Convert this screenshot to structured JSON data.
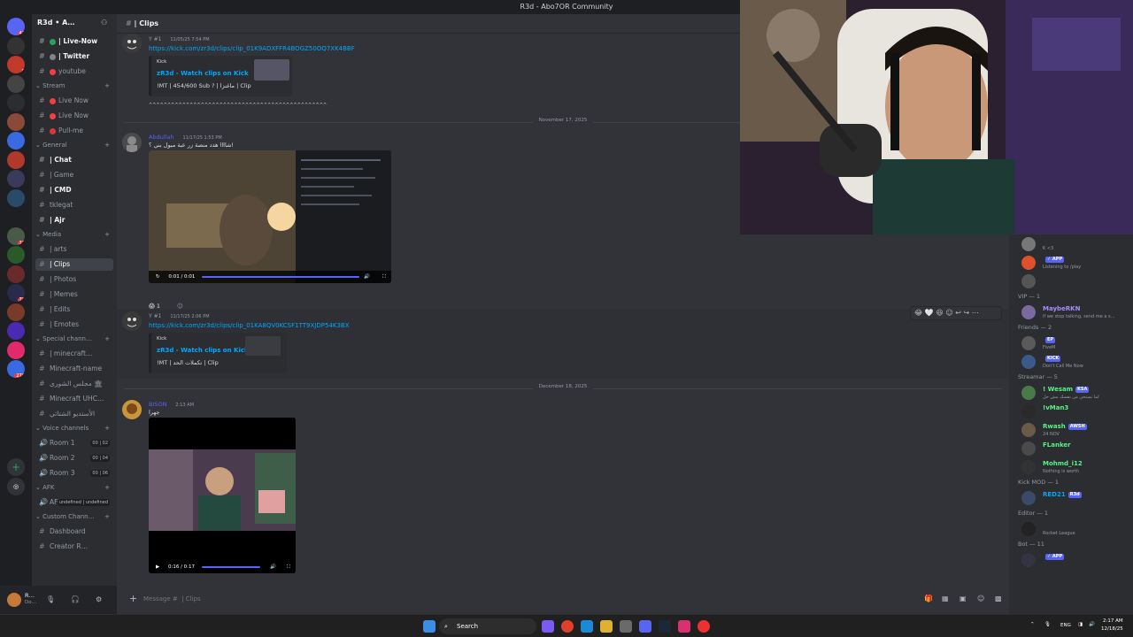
{
  "window": {
    "title": "R3d - Abo7OR Community"
  },
  "servers": [
    {
      "badge": "41"
    },
    {
      "badge": ""
    },
    {
      "badge": "5"
    },
    {
      "badge": ""
    },
    {
      "badge": ""
    },
    {
      "badge": ""
    },
    {
      "badge": ""
    },
    {
      "badge": ""
    },
    {
      "badge": ""
    },
    {
      "badge": ""
    },
    {
      "badge": ""
    },
    {
      "badge": "17"
    },
    {
      "badge": ""
    },
    {
      "badge": ""
    },
    {
      "badge": "76"
    },
    {
      "badge": ""
    },
    {
      "badge": ""
    },
    {
      "badge": "4"
    },
    {
      "badge": "276"
    }
  ],
  "guild": {
    "name": "R3d • A…"
  },
  "channels": {
    "top": [
      {
        "label": "| Live-Now",
        "dot": "#23a55a"
      },
      {
        "label": "| Twitter",
        "dot": "#80848e"
      },
      {
        "label": "youtube",
        "dot": "#f23f43"
      }
    ],
    "stream_label": "Stream",
    "stream": [
      {
        "label": "Live Now",
        "dot": "#f23f43"
      },
      {
        "label": "Live Now",
        "dot": "#f23f43"
      },
      {
        "label": "Pull-me",
        "dot": "#da373c"
      }
    ],
    "general_label": "General",
    "general": [
      {
        "label": "| Chat"
      },
      {
        "label": "| Game"
      },
      {
        "label": "| CMD"
      },
      {
        "label": "tklegat"
      },
      {
        "label": "| Ajr"
      }
    ],
    "media_label": "Media",
    "media": [
      {
        "label": "| arts"
      },
      {
        "label": "| Clips"
      },
      {
        "label": "| Photos"
      },
      {
        "label": "| Memes"
      },
      {
        "label": "| Edits"
      },
      {
        "label": "| Emotes"
      }
    ],
    "special_label": "Special chann…",
    "special": [
      {
        "label": "| minecraft…"
      },
      {
        "label": "Minecraft-name"
      },
      {
        "label": "مجلس الشورى 🏛"
      },
      {
        "label": "Minecraft UHC…"
      },
      {
        "label": "الأستديو الشتائي"
      }
    ],
    "voice_label": "Voice channels",
    "voice": [
      {
        "label": "Room 1",
        "c1": "00",
        "c2": "02"
      },
      {
        "label": "Room 2",
        "c1": "00",
        "c2": "04"
      },
      {
        "label": "Room 3",
        "c1": "00",
        "c2": "06"
      }
    ],
    "afk_label": "AFK",
    "afk": [
      {
        "label": "AFK"
      }
    ],
    "custom_label": "Custom Chann…",
    "custom": [
      {
        "label": "Dashboard"
      },
      {
        "label": "Creator R…"
      }
    ]
  },
  "user_panel": {
    "name": "R…",
    "status": "Do…"
  },
  "header": {
    "channel": "| Clips"
  },
  "messages": [
    {
      "tag": "Y #1",
      "time": "11/05/25 7:54 PM",
      "link": "https://kick.com/zr3d/clips/clip_01K9ADXFFR4BOGZ50OQ7XK4BBF",
      "embed_provider": "Kick",
      "embed_title": "zR3d - Watch clips on Kick",
      "embed_desc": "!MT | 454/600 Sub ? | ماغنزا | Clip",
      "extra": "^^^^^^^^^^^^^^^^^^^^^^^^^^^^^^^^^^^^^^^^^^^^^^^^"
    },
    {
      "date": "November 17, 2025",
      "author": "Abdullah",
      "time": "11/17/25 1:53 PM",
      "text": "شاااا هدد منصة زر عبة مبول بني ؟!",
      "video_time": "0:01 / 0:01",
      "reaction_count": "1"
    },
    {
      "tag": "Y #1",
      "time": "11/17/25 2:06 PM",
      "link": "https://kick.com/zr3d/clips/clip_01KA8QV0KCSF1TT9XJDP54K3BX",
      "embed_provider": "Kick",
      "embed_title": "zR3d - Watch clips on Kick",
      "embed_desc": "!MT | تكملات الحد | Clip"
    },
    {
      "date": "December 18, 2025",
      "author": "BISON",
      "time": "2:13 AM",
      "text": "جهرا",
      "video_time": "0:16 / 0:17"
    }
  ],
  "composer": {
    "placeholder": "Message #  | Clips"
  },
  "members": {
    "top": [
      {
        "name": "",
        "sub": "K <3",
        "color": "#f2f3f5"
      },
      {
        "name": "",
        "sub": "Listening to /play",
        "color": "#f2f3f5",
        "tag": "✓ APP"
      },
      {
        "name": "",
        "sub": "",
        "color": "#f2f3f5"
      }
    ],
    "vip_label": "VIP — 1",
    "vip": [
      {
        "name": "MaybeRKN",
        "sub": "If we stop talking, send me a s…",
        "color": "#a78bfa"
      }
    ],
    "friends_label": "Friends — 2",
    "friends": [
      {
        "name": "",
        "sub": "FiveM",
        "color": "#5865f2",
        "tag": "EP"
      },
      {
        "name": "",
        "sub": "Don't Call Me Now",
        "color": "#23a55a",
        "tag": "KICK"
      }
    ],
    "streamer_label": "Streamar — 5",
    "streamer": [
      {
        "name": "! Wesam",
        "sub": "لما تستحي من نفسك مش حل",
        "color": "#57f287",
        "tag": "KSA"
      },
      {
        "name": "!vMan3",
        "sub": "",
        "color": "#57f287"
      },
      {
        "name": "Rwash",
        "sub": "24 NOV",
        "color": "#57f287",
        "tag": "AWSH"
      },
      {
        "name": "FLanker",
        "sub": "",
        "color": "#57f287"
      },
      {
        "name": "Mohmd_i12",
        "sub": "Nothing is worth",
        "color": "#57f287"
      }
    ],
    "kickmod_label": "Kick MOD — 1",
    "kickmod": [
      {
        "name": "RED21",
        "sub": "",
        "color": "#00a8fc",
        "tag": "R3d"
      }
    ],
    "editor_label": "Editor — 1",
    "editor": [
      {
        "name": "",
        "sub": "Rocket League",
        "color": "#f2f3f5"
      }
    ],
    "bot_label": "Bot — 11",
    "bot": [
      {
        "name": "",
        "sub": "",
        "color": "#f2f3f5",
        "tag": "✓ APP"
      }
    ]
  },
  "taskbar": {
    "search": "Search",
    "lang": "ENG",
    "time": "2:17 AM",
    "date": "12/18/25"
  }
}
